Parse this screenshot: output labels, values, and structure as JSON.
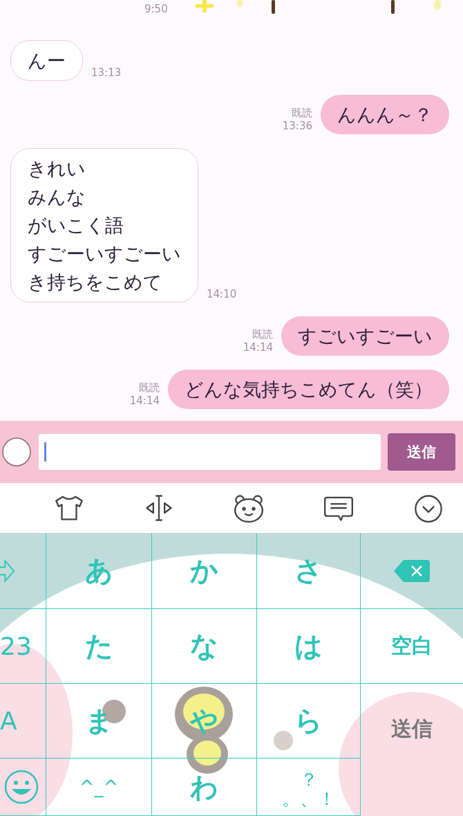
{
  "chat": {
    "top_time": "9:50",
    "messages": [
      {
        "kind": "received",
        "lines": [
          "んー"
        ],
        "time": "13:13"
      },
      {
        "kind": "sent",
        "lines": [
          "んんん～？"
        ],
        "read": "既読",
        "time": "13:36"
      },
      {
        "kind": "received",
        "lines": [
          "きれい",
          "みんな",
          "がいこく語",
          "すごーいすごーい",
          "き持ちをこめて"
        ],
        "time": "14:10"
      },
      {
        "kind": "sent",
        "lines": [
          "すごいすごーい"
        ],
        "read": "既読",
        "time": "14:14"
      },
      {
        "kind": "sent",
        "lines": [
          "どんな気持ちこめてん（笑）"
        ],
        "read": "既読",
        "time": "14:14"
      }
    ]
  },
  "input_bar": {
    "send_button": "送信"
  },
  "toolbar": [
    {
      "kind": "shirt"
    },
    {
      "kind": "cursor"
    },
    {
      "kind": "bear"
    },
    {
      "kind": "chat"
    },
    {
      "kind": "collapse"
    }
  ],
  "keyboard": {
    "keys": [
      {
        "kind": "arrow"
      },
      {
        "kind": "kana",
        "label": "あ"
      },
      {
        "kind": "kana",
        "label": "か"
      },
      {
        "kind": "kana",
        "label": "さ"
      },
      {
        "kind": "delete"
      },
      {
        "kind": "side",
        "label": "23"
      },
      {
        "kind": "kana",
        "label": "た"
      },
      {
        "kind": "kana",
        "label": "な"
      },
      {
        "kind": "kana",
        "label": "は"
      },
      {
        "kind": "space",
        "label": "空白"
      },
      {
        "kind": "side",
        "label": "A"
      },
      {
        "kind": "kana",
        "label": "ま"
      },
      {
        "kind": "kana",
        "label": "や"
      },
      {
        "kind": "kana",
        "label": "ら"
      },
      {
        "kind": "send",
        "label": "送信"
      },
      {
        "kind": "emoji"
      },
      {
        "kind": "face",
        "label": "^_^"
      },
      {
        "kind": "kana",
        "label": "わ"
      },
      {
        "kind": "symbol",
        "label": "？",
        "label_2": "。、！"
      }
    ]
  }
}
